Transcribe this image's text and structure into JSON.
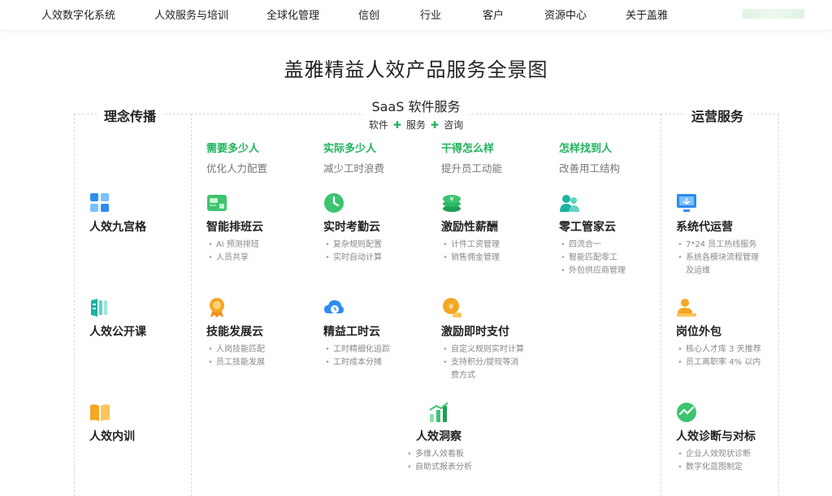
{
  "nav": {
    "items": [
      "人效数字化系统",
      "人效服务与培训",
      "全球化管理",
      "信创",
      "行业",
      "客户",
      "资源中心",
      "关于盖雅"
    ]
  },
  "page_title": "盖雅精益人效产品服务全景图",
  "left": {
    "title": "理念传播",
    "items": [
      {
        "title": "人效九宫格",
        "icon": "grid-icon"
      },
      {
        "title": "人效公开课",
        "icon": "course-icon"
      },
      {
        "title": "人效内训",
        "icon": "book-icon"
      }
    ]
  },
  "saas": {
    "title": "SaaS 软件服务",
    "sub": [
      "软件",
      "服务",
      "咨询"
    ],
    "categories": [
      {
        "q": "需要多少人",
        "s": "优化人力配置"
      },
      {
        "q": "实际多少人",
        "s": "减少工时浪费"
      },
      {
        "q": "干得怎么样",
        "s": "提升员工动能"
      },
      {
        "q": "怎样找到人",
        "s": "改善用工结构"
      }
    ],
    "products": [
      {
        "title": "智能排班云",
        "bullets": [
          "Ai 预测排班",
          "人员共享"
        ]
      },
      {
        "title": "实时考勤云",
        "bullets": [
          "复杂规则配置",
          "实时自动计算"
        ]
      },
      {
        "title": "激励性薪酬",
        "bullets": [
          "计件工资管理",
          "销售佣金管理"
        ]
      },
      {
        "title": "零工管家云",
        "bullets": [
          "四流合一",
          "智能匹配零工",
          "外包供应商管理"
        ]
      },
      {
        "title": "技能发展云",
        "bullets": [
          "人岗技能匹配",
          "员工技能发展"
        ]
      },
      {
        "title": "精益工时云",
        "bullets": [
          "工时精细化追踪",
          "工时成本分摊"
        ]
      },
      {
        "title": "激励即时支付",
        "bullets": [
          "自定义规则实时计算",
          "支持积分/提现等消",
          "费方式"
        ]
      },
      {
        "title": "人效洞察",
        "bullets": [
          "多维人效看板",
          "自助式报表分析"
        ]
      }
    ]
  },
  "right": {
    "title": "运营服务",
    "items": [
      {
        "title": "系统代运营",
        "bullets": [
          "7*24 员工热线服务",
          "系统各模块流程管理",
          "及运维"
        ]
      },
      {
        "title": "岗位外包",
        "bullets": [
          "核心人才库 3 天推荐",
          "员工离职率 4% 以内"
        ]
      },
      {
        "title": "人效诊断与对标",
        "bullets": [
          "企业人效现状诊断",
          "数字化蓝图制定"
        ]
      }
    ]
  },
  "colors": {
    "accent": "#21b35c",
    "blue": "#2d8cf0",
    "orange": "#f5a623",
    "teal": "#19b3a0"
  }
}
